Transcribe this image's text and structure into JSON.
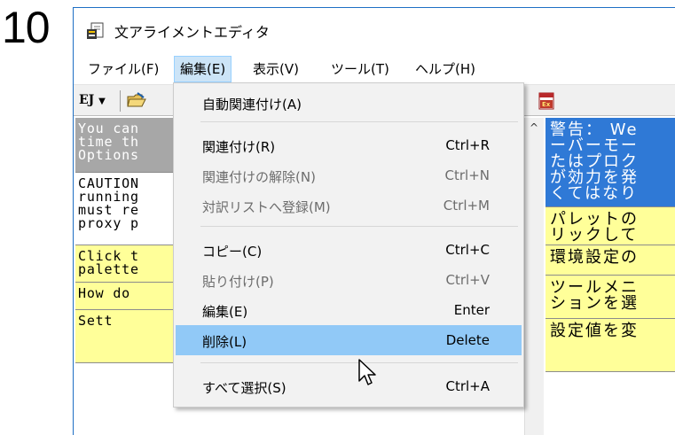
{
  "step_number": "10",
  "window": {
    "title": "文アライメントエディタ",
    "icon": "app-document-icon"
  },
  "menubar": {
    "items": [
      {
        "label": "ファイル(F)",
        "active": false
      },
      {
        "label": "編集(E)",
        "active": true
      },
      {
        "label": "表示(V)",
        "active": false
      },
      {
        "label": "ツール(T)",
        "active": false
      },
      {
        "label": "ヘルプ(H)",
        "active": false
      }
    ]
  },
  "toolbar": {
    "ej_label": "EJ",
    "ej_dropdown_icon": "dropdown-arrow-icon",
    "folder_icon": "folder-icon",
    "excel_icon": "excel-export-icon"
  },
  "left_pane": {
    "segments": [
      {
        "lines": [
          "You can",
          "time th",
          "Options"
        ],
        "color": "gray"
      },
      {
        "lines": [
          "CAUTION",
          "running",
          "must re",
          "proxy p"
        ],
        "color": "white"
      },
      {
        "lines": [
          "Click t",
          "palette"
        ],
        "color": "yellow"
      },
      {
        "lines": [
          "How do"
        ],
        "color": "yellow"
      },
      {
        "lines": [
          "Sett"
        ],
        "color": "yellow"
      }
    ]
  },
  "right_pane": {
    "segments": [
      {
        "lines": [
          "警告： We",
          "ーバーモー",
          "たはプロク",
          "が効力を発",
          "くてはなり"
        ],
        "color": "blue"
      },
      {
        "lines": [
          "パレットの",
          "リックして"
        ],
        "color": "yellow"
      },
      {
        "lines": [
          "環境設定の"
        ],
        "color": "yellow"
      },
      {
        "lines": [
          "ツールメニ",
          "ションを選"
        ],
        "color": "yellow"
      },
      {
        "lines": [
          "設定値を変"
        ],
        "color": "yellow"
      }
    ]
  },
  "scrollbar": {
    "up_arrow": "^"
  },
  "edit_menu": {
    "items": [
      {
        "label": "自動関連付け(A)",
        "shortcut": "",
        "disabled": false,
        "highlight": false
      },
      {
        "separator": true
      },
      {
        "label": "関連付け(R)",
        "shortcut": "Ctrl+R",
        "disabled": false,
        "highlight": false
      },
      {
        "label": "関連付けの解除(N)",
        "shortcut": "Ctrl+N",
        "disabled": true,
        "highlight": false
      },
      {
        "label": "対訳リストへ登録(M)",
        "shortcut": "Ctrl+M",
        "disabled": true,
        "highlight": false
      },
      {
        "separator": true
      },
      {
        "label": "コピー(C)",
        "shortcut": "Ctrl+C",
        "disabled": false,
        "highlight": false
      },
      {
        "label": "貼り付け(P)",
        "shortcut": "Ctrl+V",
        "disabled": true,
        "highlight": false
      },
      {
        "label": "編集(E)",
        "shortcut": "Enter",
        "disabled": false,
        "highlight": false
      },
      {
        "label": "削除(L)",
        "shortcut": "Delete",
        "disabled": false,
        "highlight": true
      },
      {
        "separator": true
      },
      {
        "label": "すべて選択(S)",
        "shortcut": "Ctrl+A",
        "disabled": false,
        "highlight": false
      }
    ]
  },
  "cursor_icon": "mouse-pointer-icon",
  "colors": {
    "highlight": "#91c9f7",
    "active_menu": "#cce4f7",
    "selected_segment": "#2f79d6",
    "gray_segment": "#a7a7a7",
    "yellow_segment": "#ffff99",
    "disabled_text": "#6d6d6d"
  }
}
